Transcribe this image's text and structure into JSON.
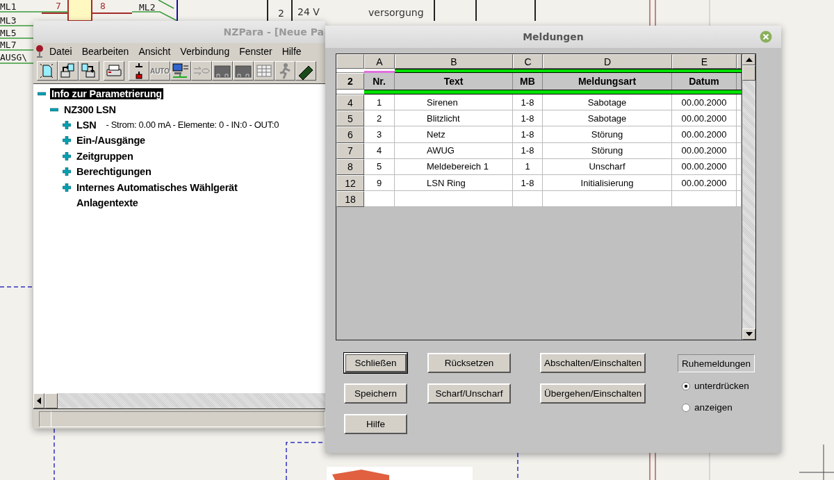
{
  "schematic": {
    "labels": [
      {
        "kind": "net",
        "text": "ML1"
      },
      {
        "kind": "net",
        "text": "ML3"
      },
      {
        "kind": "net",
        "text": "ML5"
      },
      {
        "kind": "net",
        "text": "ML7"
      },
      {
        "kind": "net",
        "text": "AUSG\\"
      },
      {
        "kind": "pin",
        "text": "7"
      },
      {
        "kind": "pin",
        "text": "8"
      },
      {
        "kind": "net",
        "text": "ML2"
      },
      {
        "kind": "cell",
        "text": "2"
      },
      {
        "kind": "cell",
        "text": "24 V"
      },
      {
        "kind": "cell",
        "text": "versorgung"
      }
    ]
  },
  "main_window": {
    "title": "NZPara - [Neue Pa",
    "menu": [
      {
        "label": "Datei"
      },
      {
        "label": "Bearbeiten"
      },
      {
        "label": "Ansicht"
      },
      {
        "label": "Verbindung"
      },
      {
        "label": "Fenster"
      },
      {
        "label": "Hilfe"
      }
    ],
    "toolbar": [
      {
        "kind": "new"
      },
      {
        "kind": "upload"
      },
      {
        "kind": "download"
      },
      {
        "kind": "print"
      },
      {
        "kind": "plug"
      },
      {
        "kind": "auto",
        "label": "AUTO"
      },
      {
        "kind": "network"
      },
      {
        "kind": "transfer"
      },
      {
        "kind": "module"
      },
      {
        "kind": "module"
      },
      {
        "kind": "table"
      },
      {
        "kind": "person"
      },
      {
        "kind": "chip"
      }
    ],
    "tree": [
      {
        "label": "Info zur Parametrierung",
        "expanded": true,
        "selected": true,
        "children": [
          {
            "label": "NZ300 LSN",
            "expanded": true,
            "selected": false,
            "children": [
              {
                "label": "LSN",
                "detail": "- Strom: 0.00 mA - Elemente: 0 - IN:0 - OUT:0",
                "expanded": false,
                "selected": false
              },
              {
                "label": "Ein-/Ausgänge",
                "expanded": false,
                "selected": false
              },
              {
                "label": "Zeitgruppen",
                "expanded": false,
                "selected": false
              },
              {
                "label": "Berechtigungen",
                "expanded": false,
                "selected": false
              },
              {
                "label": "Internes Automatisches Wählgerät",
                "expanded": false,
                "selected": false
              },
              {
                "label": "Anlagentexte",
                "selected": false
              }
            ]
          }
        ]
      }
    ]
  },
  "dialog": {
    "title": "Meldungen",
    "grid": {
      "columns": [
        "A",
        "B",
        "C",
        "D",
        "E"
      ],
      "header_row": {
        "number": "2",
        "cells": [
          "Nr.",
          "Text",
          "MB",
          "Meldungsart",
          "Datum"
        ]
      },
      "rows": [
        {
          "number": "4",
          "cells": [
            "1",
            "Sirenen",
            "1-8",
            "Sabotage",
            "00.00.2000"
          ]
        },
        {
          "number": "5",
          "cells": [
            "2",
            "Blitzlicht",
            "1-8",
            "Sabotage",
            "00.00.2000"
          ]
        },
        {
          "number": "6",
          "cells": [
            "3",
            "Netz",
            "1-8",
            "Störung",
            "00.00.2000"
          ]
        },
        {
          "number": "7",
          "cells": [
            "4",
            "AWUG",
            "1-8",
            "Störung",
            "00.00.2000"
          ]
        },
        {
          "number": "8",
          "cells": [
            "5",
            "Meldebereich 1",
            "1",
            "Unscharf",
            "00.00.2000"
          ]
        },
        {
          "number": "12",
          "cells": [
            "9",
            "LSN Ring",
            "1-8",
            "Initialisierung",
            "00.00.2000"
          ]
        },
        {
          "number": "18"
        }
      ]
    },
    "buttons": [
      {
        "label": "Schließen",
        "default": true
      },
      {
        "label": "Rücksetzen",
        "default": false
      },
      {
        "label": "Abschalten/Einschalten",
        "default": false
      },
      {
        "label": "Speichern",
        "default": false
      },
      {
        "label": "Scharf/Unscharf",
        "default": false
      },
      {
        "label": "Übergehen/Einschalten",
        "default": false
      },
      {
        "label": "Hilfe",
        "default": false
      }
    ],
    "group": {
      "label": "Ruhemeldungen",
      "options": [
        {
          "label": "unterdrücken",
          "selected": true
        },
        {
          "label": "anzeigen",
          "selected": false
        }
      ]
    }
  }
}
